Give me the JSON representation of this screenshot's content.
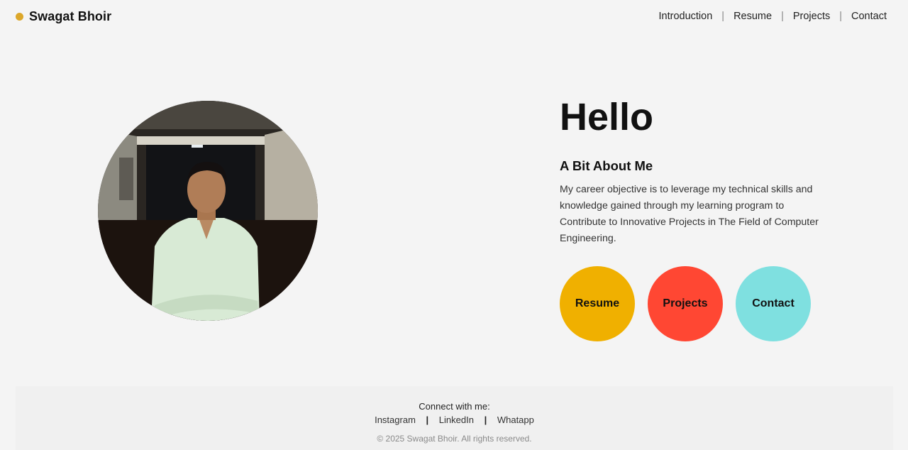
{
  "header": {
    "brand_name": "Swagat Bhoir",
    "brand_dot_color": "#dca72a",
    "nav": [
      "Introduction",
      "Resume",
      "Projects",
      "Contact"
    ],
    "separator": "|"
  },
  "hero": {
    "photo_alt": "Swagat Bhoir",
    "heading": "Hello",
    "subheading": "A Bit About Me",
    "description": "My career objective is to leverage my technical skills and knowledge gained through my learning program to Contribute to Innovative Projects in The Field of Computer Engineering.",
    "buttons": [
      {
        "label": "Resume",
        "color": "#f0b000"
      },
      {
        "label": "Projects",
        "color": "#ff4733"
      },
      {
        "label": "Contact",
        "color": "#7fe0e0"
      }
    ]
  },
  "footer": {
    "connect_label": "Connect with me:",
    "socials": [
      "Instagram",
      "LinkedIn",
      "Whatapp"
    ],
    "separator": "|",
    "copyright": "© 2025 Swagat Bhoir. All rights reserved."
  }
}
